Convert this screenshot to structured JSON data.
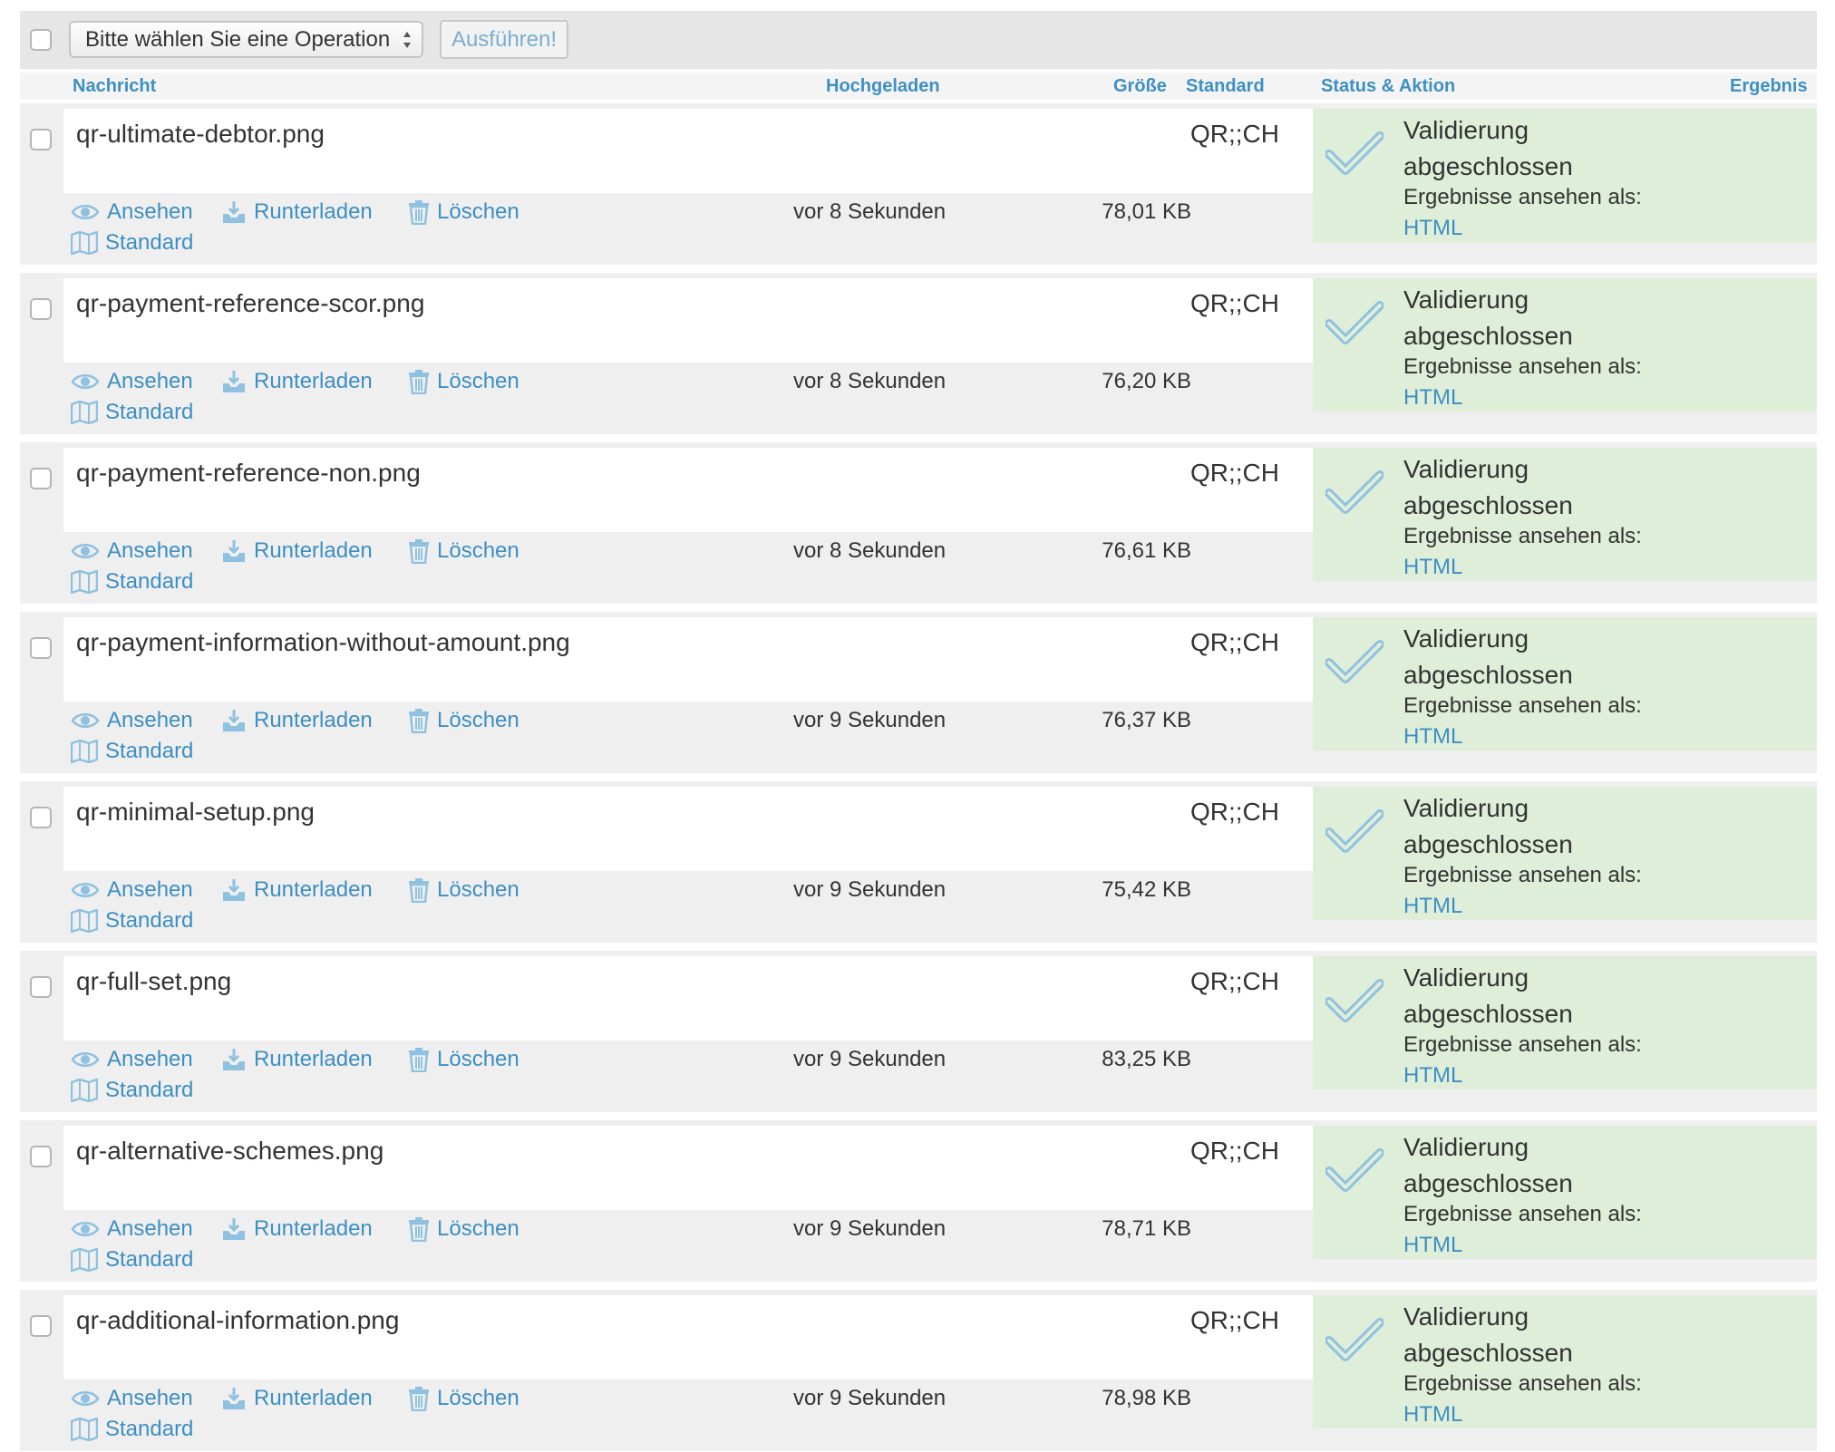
{
  "toolbar": {
    "operation_select": "Bitte wählen Sie eine Operation",
    "run_button": "Ausführen!"
  },
  "columns": {
    "message": "Nachricht",
    "uploaded": "Hochgeladen",
    "size": "Größe",
    "standard": "Standard",
    "status_action": "Status & Aktion",
    "result": "Ergebnis"
  },
  "actions": {
    "view": "Ansehen",
    "download": "Runterladen",
    "delete": "Löschen",
    "standard": "Standard"
  },
  "status": {
    "title": "Validierung abgeschlossen",
    "results_as": "Ergebnisse ansehen als:",
    "format_link": "HTML"
  },
  "icons": [
    "checkbox",
    "eye-icon",
    "download-icon",
    "trash-icon",
    "map-icon",
    "checkmark-icon",
    "select-arrows-icon"
  ],
  "colors": {
    "link": "#3d8fc4",
    "status_bg": "#dfeed9",
    "row_bg": "#efefef",
    "toolbar_bg": "#e6e6e6"
  },
  "rows": [
    {
      "filename": "qr-ultimate-debtor.png",
      "standard": "QR;;CH",
      "uploaded": "vor 8 Sekunden",
      "size": "78,01 KB"
    },
    {
      "filename": "qr-payment-reference-scor.png",
      "standard": "QR;;CH",
      "uploaded": "vor 8 Sekunden",
      "size": "76,20 KB"
    },
    {
      "filename": "qr-payment-reference-non.png",
      "standard": "QR;;CH",
      "uploaded": "vor 8 Sekunden",
      "size": "76,61 KB"
    },
    {
      "filename": "qr-payment-information-without-amount.png",
      "standard": "QR;;CH",
      "uploaded": "vor 9 Sekunden",
      "size": "76,37 KB"
    },
    {
      "filename": "qr-minimal-setup.png",
      "standard": "QR;;CH",
      "uploaded": "vor 9 Sekunden",
      "size": "75,42 KB"
    },
    {
      "filename": "qr-full-set.png",
      "standard": "QR;;CH",
      "uploaded": "vor 9 Sekunden",
      "size": "83,25 KB"
    },
    {
      "filename": "qr-alternative-schemes.png",
      "standard": "QR;;CH",
      "uploaded": "vor 9 Sekunden",
      "size": "78,71 KB"
    },
    {
      "filename": "qr-additional-information.png",
      "standard": "QR;;CH",
      "uploaded": "vor 9 Sekunden",
      "size": "78,98 KB"
    }
  ]
}
